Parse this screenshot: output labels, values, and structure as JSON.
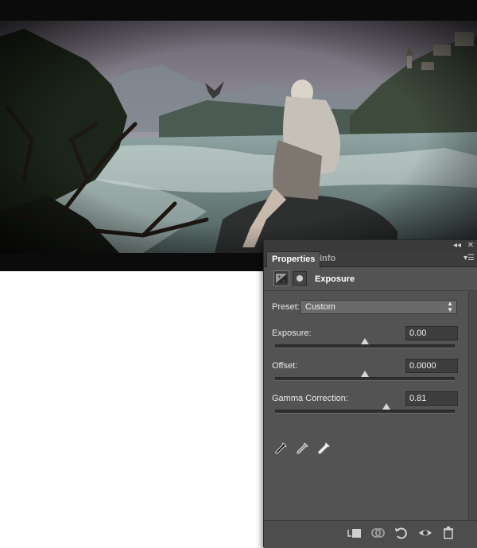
{
  "panel": {
    "tabs": [
      {
        "label": "Properties",
        "active": true
      },
      {
        "label": "Info",
        "active": false
      }
    ],
    "title": "Exposure",
    "preset": {
      "label": "Preset:",
      "value": "Custom"
    },
    "controls": [
      {
        "label": "Exposure:",
        "value": "0.00",
        "slider_position": 0.5
      },
      {
        "label": "Offset:",
        "value": "0.0000",
        "slider_position": 0.5
      },
      {
        "label": "Gamma Correction:",
        "value": "0.81",
        "slider_position": 0.62
      }
    ],
    "eyedroppers": [
      "black-point-eyedropper-icon",
      "gray-point-eyedropper-icon",
      "white-point-eyedropper-icon"
    ],
    "footer_buttons": [
      "clip-to-layer-icon",
      "view-previous-state-icon",
      "reset-icon",
      "visibility-eye-icon",
      "trash-icon"
    ]
  },
  "colors": {
    "panel_bg": "#535353",
    "tab_bar": "#3c3c3c",
    "value_box": "#3e3e3e"
  }
}
